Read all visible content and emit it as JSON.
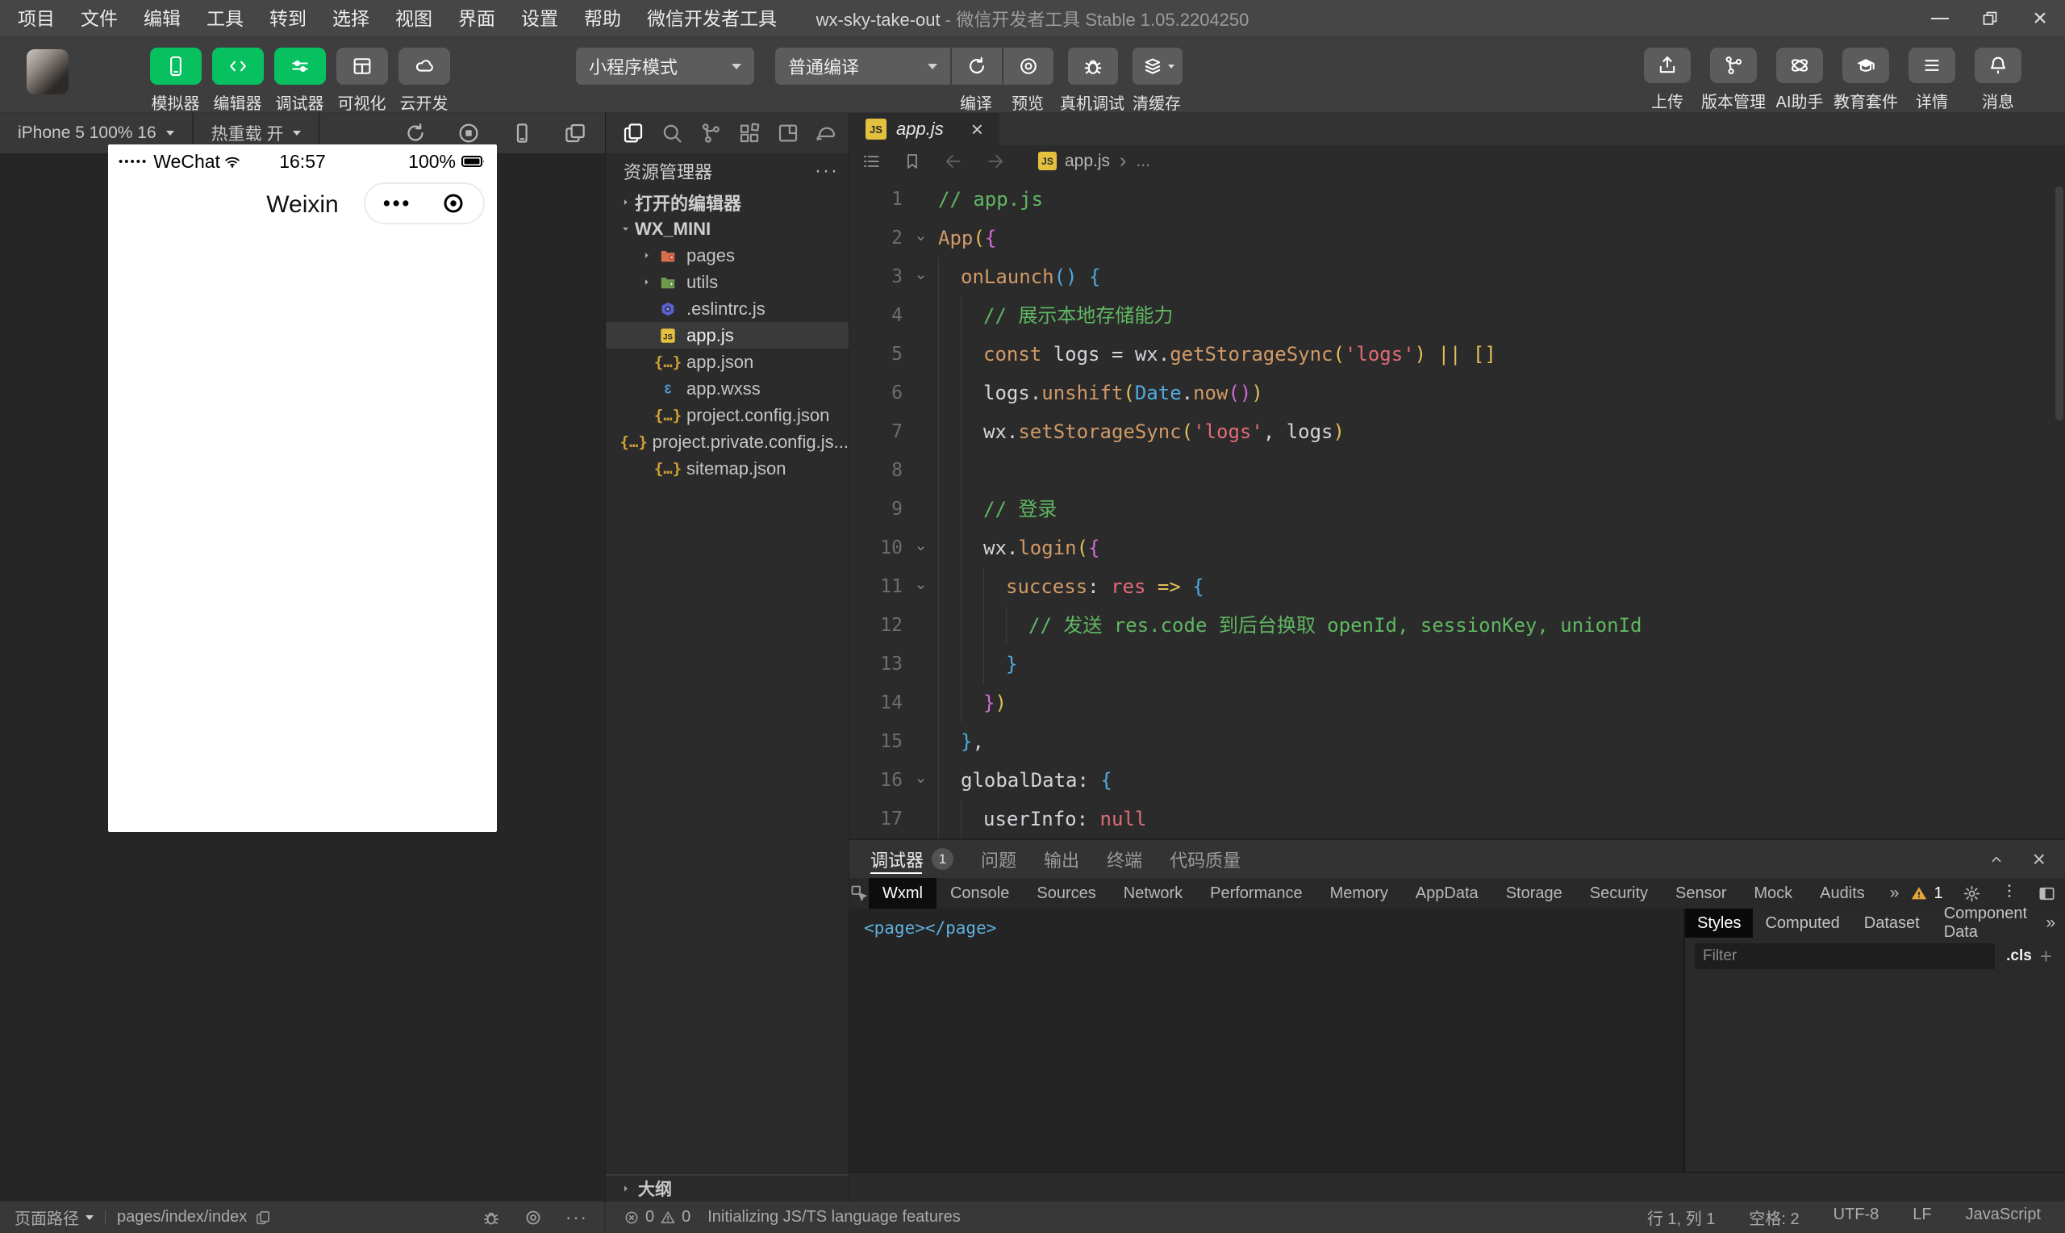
{
  "window": {
    "menus": [
      "项目",
      "文件",
      "编辑",
      "工具",
      "转到",
      "选择",
      "视图",
      "界面",
      "设置",
      "帮助",
      "微信开发者工具"
    ],
    "project": "wx-sky-take-out",
    "suffix": " - 微信开发者工具 Stable 1.05.2204250",
    "close_glyph": "×"
  },
  "glyphs": {
    "more_h": "···",
    "overflow": "»",
    "breadcrumb_sep": "›"
  },
  "toolbar": {
    "tools": [
      {
        "name": "simulator-button",
        "label": "模拟器",
        "icon": "phone-icon",
        "active": true
      },
      {
        "name": "editor-button",
        "label": "编辑器",
        "icon": "code-icon",
        "active": true
      },
      {
        "name": "debugger-button",
        "label": "调试器",
        "icon": "tuner-icon",
        "active": true
      },
      {
        "name": "visualizer-button",
        "label": "可视化",
        "icon": "layout-icon",
        "active": false
      },
      {
        "name": "cloud-dev-button",
        "label": "云开发",
        "icon": "cloud-icon",
        "active": false
      }
    ],
    "mode_select": {
      "value": "小程序模式"
    },
    "compile_select": {
      "value": "普通编译"
    },
    "compile_tools": [
      {
        "name": "compile-button",
        "label": "编译",
        "icon": "refresh-icon",
        "sep": false,
        "caret": false
      },
      {
        "name": "preview-button",
        "label": "预览",
        "icon": "eye-icon",
        "sep": false,
        "caret": false
      },
      {
        "name": "device-debug-button",
        "label": "真机调试",
        "icon": "bug-icon",
        "sep": true,
        "caret": false
      },
      {
        "name": "clear-cache-button",
        "label": "清缓存",
        "icon": "stack-icon",
        "sep": true,
        "caret": true
      }
    ],
    "right_tools": [
      {
        "name": "upload-button",
        "label": "上传",
        "icon": "upload-icon"
      },
      {
        "name": "version-control-button",
        "label": "版本管理",
        "icon": "branch-icon"
      },
      {
        "name": "ai-assistant-button",
        "label": "AI助手",
        "icon": "atom-icon"
      },
      {
        "name": "education-suite-button",
        "label": "教育套件",
        "icon": "grad-cap-icon"
      },
      {
        "name": "details-button",
        "label": "详情",
        "icon": "hamburger-icon"
      },
      {
        "name": "messages-button",
        "label": "消息",
        "icon": "bell-icon"
      }
    ]
  },
  "simulator": {
    "device_select": "iPhone 5 100% 16",
    "hot_reload": "热重载 开",
    "icons": [
      "refresh-icon",
      "stop-icon",
      "phone-outline-icon",
      "windows-icon"
    ],
    "phone": {
      "signal_dots": "•••••",
      "carrier": "WeChat",
      "time": "16:57",
      "battery": "100%",
      "nav_title": "Weixin",
      "capsule_dots": "•••"
    }
  },
  "explorer": {
    "activity_icons": [
      {
        "icon": "files-icon",
        "active": true
      },
      {
        "icon": "search-icon",
        "active": false
      },
      {
        "icon": "source-control-icon",
        "active": false
      },
      {
        "icon": "extensions-icon",
        "active": false
      },
      {
        "icon": "preview-icon",
        "active": false
      },
      {
        "icon": "whale-icon",
        "active": false
      }
    ],
    "title": "资源管理器",
    "files": [
      {
        "label": "打开的编辑器",
        "arrow": "right",
        "root": true
      },
      {
        "label": "WX_MINI",
        "arrow": "down",
        "root": true
      },
      {
        "label": "pages",
        "icon": "folder-pages-icon",
        "arrow": "right"
      },
      {
        "label": "utils",
        "icon": "folder-utils-icon",
        "arrow": "right"
      },
      {
        "label": ".eslintrc.js",
        "icon": "eslint-icon"
      },
      {
        "label": "app.js",
        "icon": "js-icon",
        "selected": true
      },
      {
        "label": "app.json",
        "icon": "json-icon"
      },
      {
        "label": "app.wxss",
        "icon": "wxss-icon"
      },
      {
        "label": "project.config.json",
        "icon": "json-icon"
      },
      {
        "label": "project.private.config.js...",
        "icon": "json-icon"
      },
      {
        "label": "sitemap.json",
        "icon": "json-icon"
      }
    ],
    "outline": "大纲"
  },
  "editor": {
    "tab": {
      "label": "app.js",
      "close": "×"
    },
    "breadcrumb": {
      "file": "app.js",
      "more": "..."
    },
    "lines": [
      {
        "n": "1",
        "ind": 0,
        "fold": false,
        "tokens": [
          [
            "// app.js",
            "g"
          ]
        ]
      },
      {
        "n": "2",
        "ind": 0,
        "fold": true,
        "tokens": [
          [
            "App",
            "o"
          ],
          [
            "(",
            "y"
          ],
          [
            "{",
            "m"
          ]
        ]
      },
      {
        "n": "3",
        "ind": 1,
        "fold": true,
        "tokens": [
          [
            "onLaunch",
            "o"
          ],
          [
            "()",
            "b"
          ],
          [
            " ",
            "w"
          ],
          [
            "{",
            "b"
          ]
        ]
      },
      {
        "n": "4",
        "ind": 2,
        "fold": false,
        "tokens": [
          [
            "// 展示本地存储能力",
            "g"
          ]
        ]
      },
      {
        "n": "5",
        "ind": 2,
        "fold": false,
        "tokens": [
          [
            "const",
            "o"
          ],
          [
            " logs = wx.",
            "w"
          ],
          [
            "getStorageSync",
            "o"
          ],
          [
            "(",
            "y"
          ],
          [
            "'logs'",
            "r"
          ],
          [
            ")",
            "y"
          ],
          [
            " ",
            "w"
          ],
          [
            "||",
            "y"
          ],
          [
            " ",
            "w"
          ],
          [
            "[]",
            "y"
          ]
        ]
      },
      {
        "n": "6",
        "ind": 2,
        "fold": false,
        "tokens": [
          [
            "logs.",
            "w"
          ],
          [
            "unshift",
            "o"
          ],
          [
            "(",
            "y"
          ],
          [
            "Date",
            "b"
          ],
          [
            ".",
            "w"
          ],
          [
            "now",
            "o"
          ],
          [
            "()",
            "m"
          ],
          [
            ")",
            "y"
          ]
        ]
      },
      {
        "n": "7",
        "ind": 2,
        "fold": false,
        "tokens": [
          [
            "wx.",
            "w"
          ],
          [
            "setStorageSync",
            "o"
          ],
          [
            "(",
            "y"
          ],
          [
            "'logs'",
            "r"
          ],
          [
            ", logs",
            "w"
          ],
          [
            ")",
            "y"
          ]
        ]
      },
      {
        "n": "8",
        "ind": 2,
        "fold": false,
        "tokens": []
      },
      {
        "n": "9",
        "ind": 2,
        "fold": false,
        "tokens": [
          [
            "// 登录",
            "g"
          ]
        ]
      },
      {
        "n": "10",
        "ind": 2,
        "fold": true,
        "tokens": [
          [
            "wx.",
            "w"
          ],
          [
            "login",
            "o"
          ],
          [
            "(",
            "y"
          ],
          [
            "{",
            "m"
          ]
        ]
      },
      {
        "n": "11",
        "ind": 3,
        "fold": true,
        "tokens": [
          [
            "success",
            "o"
          ],
          [
            ": ",
            "w"
          ],
          [
            "res",
            "r"
          ],
          [
            " ",
            "w"
          ],
          [
            "=>",
            "y"
          ],
          [
            " ",
            "w"
          ],
          [
            "{",
            "b"
          ]
        ]
      },
      {
        "n": "12",
        "ind": 4,
        "fold": false,
        "tokens": [
          [
            "// 发送 res.code 到后台换取 openId, sessionKey, unionId",
            "g"
          ]
        ]
      },
      {
        "n": "13",
        "ind": 3,
        "fold": false,
        "tokens": [
          [
            "}",
            "b"
          ]
        ]
      },
      {
        "n": "14",
        "ind": 2,
        "fold": false,
        "tokens": [
          [
            "}",
            "m"
          ],
          [
            ")",
            "y"
          ]
        ]
      },
      {
        "n": "15",
        "ind": 1,
        "fold": false,
        "tokens": [
          [
            "}",
            "b"
          ],
          [
            ",",
            "w"
          ]
        ]
      },
      {
        "n": "16",
        "ind": 1,
        "fold": true,
        "tokens": [
          [
            "globalData",
            "w"
          ],
          [
            ": ",
            "w"
          ],
          [
            "{",
            "b"
          ]
        ]
      },
      {
        "n": "17",
        "ind": 2,
        "fold": false,
        "tokens": [
          [
            "userInfo",
            "w"
          ],
          [
            ": ",
            "w"
          ],
          [
            "null",
            "r"
          ]
        ]
      }
    ]
  },
  "debugger": {
    "panel_tabs": [
      {
        "label": "调试器",
        "badge": "1",
        "active": true
      },
      {
        "label": "问题",
        "active": false
      },
      {
        "label": "输出",
        "active": false
      },
      {
        "label": "终端",
        "active": false
      },
      {
        "label": "代码质量",
        "active": false
      }
    ],
    "devtools_tabs": [
      {
        "label": "Wxml",
        "active": true
      },
      {
        "label": "Console",
        "active": false
      },
      {
        "label": "Sources",
        "active": false
      },
      {
        "label": "Network",
        "active": false
      },
      {
        "label": "Performance",
        "active": false
      },
      {
        "label": "Memory",
        "active": false
      },
      {
        "label": "AppData",
        "active": false
      },
      {
        "label": "Storage",
        "active": false
      },
      {
        "label": "Security",
        "active": false
      },
      {
        "label": "Sensor",
        "active": false
      },
      {
        "label": "Mock",
        "active": false
      },
      {
        "label": "Audits",
        "active": false
      }
    ],
    "warning_count": "1",
    "elements_content": "<page></page>",
    "styles_tabs": [
      {
        "label": "Styles",
        "active": true
      },
      {
        "label": "Computed",
        "active": false
      },
      {
        "label": "Dataset",
        "active": false
      },
      {
        "label": "Component Data",
        "active": false
      }
    ],
    "filter_placeholder": "Filter",
    "cls_label": ".cls",
    "add_label": "+"
  },
  "statusbar": {
    "left_label": "页面路径",
    "path": "pages/index/index",
    "error_count": "0",
    "warning_count": "0",
    "message": "Initializing JS/TS language features",
    "right_items": [
      "行 1, 列 1",
      "空格: 2",
      "UTF-8",
      "LF",
      "JavaScript"
    ]
  },
  "colors": {
    "accent_green": "#07c160",
    "warning_yellow": "#e0a63a",
    "selection_gray": "#3a3a3a"
  }
}
